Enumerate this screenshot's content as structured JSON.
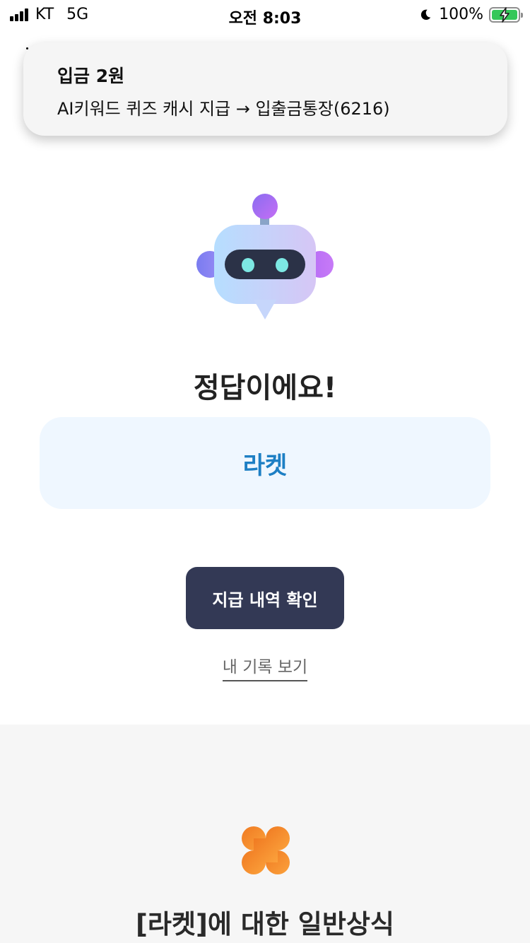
{
  "status_bar": {
    "carrier": "KT",
    "network": "5G",
    "time": "오전 8:03",
    "battery_percent": "100%"
  },
  "notification": {
    "title": "입금 2원",
    "body": "AI키워드 퀴즈 캐시 지급 → 입출금통장(6216)"
  },
  "result": {
    "title": "정답이에요!",
    "answer": "라켓"
  },
  "actions": {
    "history_button_label": "지급 내역 확인",
    "my_record_link_label": "내 기록 보기"
  },
  "info_section": {
    "title": "[라켓]에 대한 일반상식"
  },
  "colors": {
    "primary_button": "#333955",
    "answer_text": "#1d7fc4",
    "answer_box": "#eff7ff",
    "clover": "#f28c28"
  }
}
